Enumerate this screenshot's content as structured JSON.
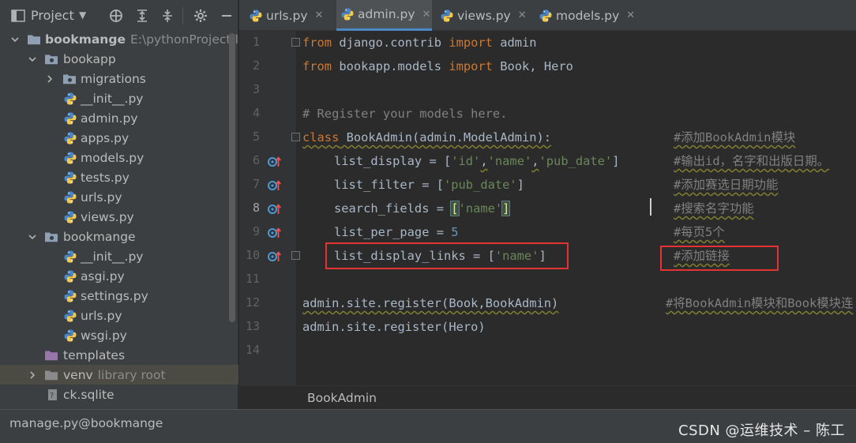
{
  "project_panel": {
    "title": "Project",
    "tree": [
      {
        "label": "bookmange",
        "sub": "E:\\pythonProject\\lin"
      },
      {
        "label": "bookapp"
      },
      {
        "label": "migrations"
      },
      {
        "label": "__init__.py"
      },
      {
        "label": "admin.py"
      },
      {
        "label": "apps.py"
      },
      {
        "label": "models.py"
      },
      {
        "label": "tests.py"
      },
      {
        "label": "urls.py"
      },
      {
        "label": "views.py"
      },
      {
        "label": "bookmange"
      },
      {
        "label": "__init__.py"
      },
      {
        "label": "asgi.py"
      },
      {
        "label": "settings.py"
      },
      {
        "label": "urls.py"
      },
      {
        "label": "wsgi.py"
      },
      {
        "label": "templates"
      },
      {
        "label": "venv",
        "sub": "library root"
      },
      {
        "label": "ck.sqlite"
      }
    ]
  },
  "tabs": [
    {
      "label": "urls.py"
    },
    {
      "label": "admin.py"
    },
    {
      "label": "views.py"
    },
    {
      "label": "models.py"
    }
  ],
  "editor": {
    "line_numbers": [
      "1",
      "2",
      "3",
      "4",
      "5",
      "6",
      "7",
      "8",
      "9",
      "10",
      "11",
      "12",
      "13",
      "14"
    ],
    "current_line": "8",
    "line1": {
      "kw1": "from",
      "mod": " django.contrib ",
      "kw2": "import",
      "rest": " admin"
    },
    "line2": {
      "kw1": "from",
      "mod": " bookapp.models ",
      "kw2": "import",
      "rest": " Book, Hero"
    },
    "line4": {
      "comment": "# Register your models here."
    },
    "line5": {
      "kw": "class",
      "rest": " BookAdmin(admin.ModelAdmin):",
      "comment": "#添加BookAdmin模块"
    },
    "line6": {
      "name": "list_display = [",
      "s1": "'id'",
      "sep1": ",",
      "s2": "'name'",
      "sep2": ",",
      "s3": "'pub_date'",
      "end": "]",
      "comment": "#输出id，名字和出版日期。"
    },
    "line7": {
      "name": "list_filter = [",
      "s1": "'pub_date'",
      "end": "]",
      "comment": "#添加赛选日期功能"
    },
    "line8": {
      "name": "search_fields = ",
      "open": "[",
      "s1": "'name'",
      "close": "]",
      "comment": "#搜索名字功能"
    },
    "line9": {
      "name": "list_per_page = ",
      "num": "5",
      "comment": "#每页5个"
    },
    "line10": {
      "name": "list_display_links = [",
      "s1": "'name'",
      "end": "]",
      "comment": "#添加链接"
    },
    "line12": {
      "code": "admin.site.register(Book,BookAdmin)",
      "comment": "#将BookAdmin模块和Book模块连"
    },
    "line13": {
      "code": "admin.site.register(Hero)"
    }
  },
  "breadcrumb": "BookAdmin",
  "status_bar": {
    "left": "manage.py@bookmange",
    "watermark": "CSDN @运维技术 – 陈工"
  },
  "colors": {
    "keyword": "#cc7832",
    "string": "#6a8759",
    "number": "#6897bb",
    "comment": "#808080",
    "highlight_box": "#e53333",
    "folder": "#8fa0b4",
    "python_blue": "#4a86c8",
    "python_yellow": "#f2c94c"
  }
}
